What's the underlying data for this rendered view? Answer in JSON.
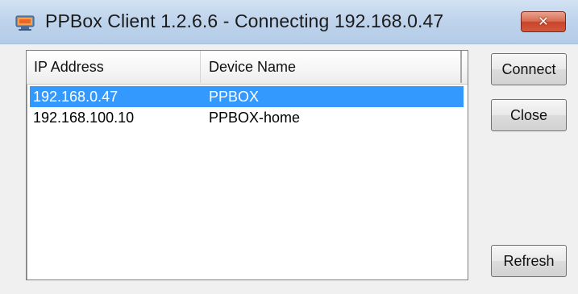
{
  "window": {
    "title": "PPBox Client 1.2.6.6 - Connecting 192.168.0.47",
    "app_icon": "ppbox-app-icon",
    "close_icon": "close-x-icon",
    "close_glyph": "✕"
  },
  "list": {
    "columns": [
      "IP Address",
      "Device Name"
    ],
    "rows": [
      {
        "ip": "192.168.0.47",
        "name": "PPBOX",
        "selected": true
      },
      {
        "ip": "192.168.100.10",
        "name": "PPBOX-home",
        "selected": false
      }
    ],
    "selection_color": "#3399ff"
  },
  "buttons": {
    "connect": "Connect",
    "close": "Close",
    "refresh": "Refresh"
  }
}
